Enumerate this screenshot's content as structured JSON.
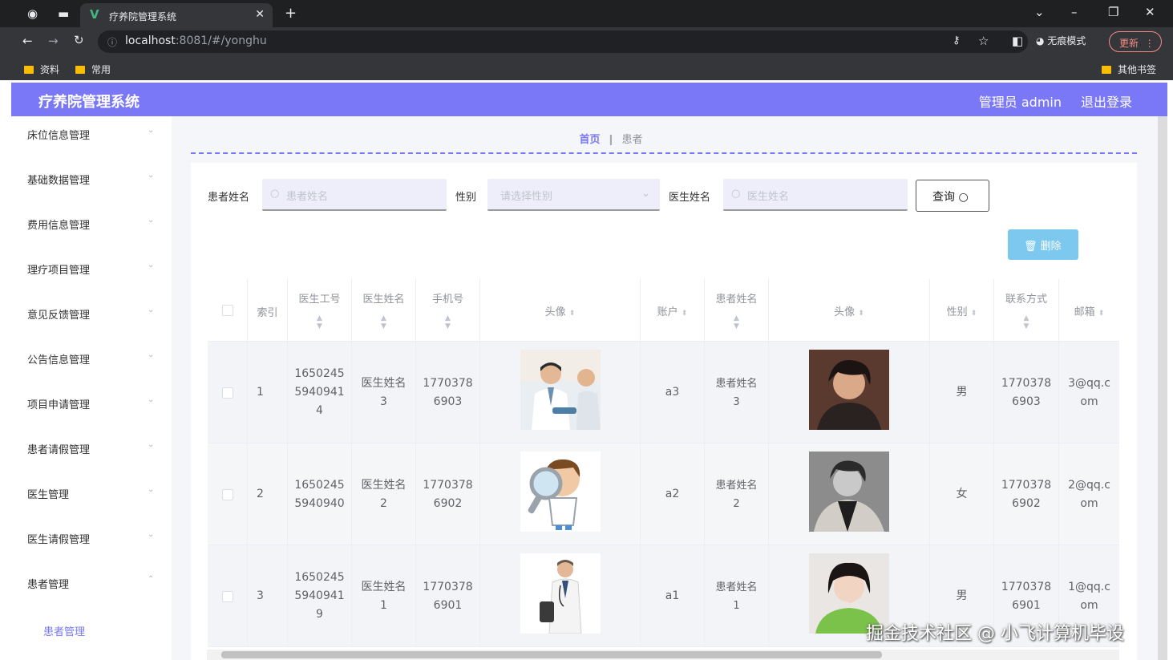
{
  "browser": {
    "tab_title": "疗养院管理系统",
    "url_host": "localhost",
    "url_rest": ":8081/#/yonghu",
    "incognito_label": "无痕模式",
    "update_label": "更新",
    "bookmarks": [
      "资料",
      "常用"
    ],
    "other_bookmarks": "其他书签"
  },
  "header": {
    "title": "疗养院管理系统",
    "admin": "管理员 admin",
    "logout": "退出登录"
  },
  "sidebar": {
    "items": [
      {
        "label": "床位信息管理"
      },
      {
        "label": "基础数据管理"
      },
      {
        "label": "费用信息管理"
      },
      {
        "label": "理疗项目管理"
      },
      {
        "label": "意见反馈管理"
      },
      {
        "label": "公告信息管理"
      },
      {
        "label": "项目申请管理"
      },
      {
        "label": "患者请假管理"
      },
      {
        "label": "医生管理"
      },
      {
        "label": "医生请假管理"
      },
      {
        "label": "患者管理"
      }
    ],
    "sub_item": "患者管理"
  },
  "breadcrumb": {
    "home": "首页",
    "current": "患者"
  },
  "filters": {
    "patient_name_label": "患者姓名",
    "patient_name_placeholder": "患者姓名",
    "gender_label": "性别",
    "gender_placeholder": "请选择性别",
    "doctor_name_label": "医生姓名",
    "doctor_name_placeholder": "医生姓名",
    "query_label": "查询",
    "delete_label": "删除"
  },
  "table": {
    "headers": [
      "索引",
      "医生工号",
      "医生姓名",
      "手机号",
      "头像",
      "账户",
      "患者姓名",
      "头像",
      "性别",
      "联系方式",
      "邮箱"
    ],
    "rows": [
      {
        "index": "1",
        "doc_id": [
          "1650245",
          "5940941",
          "4"
        ],
        "doc_name": [
          "医生姓名",
          "3"
        ],
        "phone": [
          "1770378",
          "6903"
        ],
        "account": "a3",
        "patient": [
          "患者姓名",
          "3"
        ],
        "gender": "男",
        "contact": [
          "1770378",
          "6903"
        ],
        "email": [
          "3@qq.c",
          "om"
        ]
      },
      {
        "index": "2",
        "doc_id": [
          "1650245",
          "5940940"
        ],
        "doc_name": [
          "医生姓名",
          "2"
        ],
        "phone": [
          "1770378",
          "6902"
        ],
        "account": "a2",
        "patient": [
          "患者姓名",
          "2"
        ],
        "gender": "女",
        "contact": [
          "1770378",
          "6902"
        ],
        "email": [
          "2@qq.c",
          "om"
        ]
      },
      {
        "index": "3",
        "doc_id": [
          "1650245",
          "5940941",
          "9"
        ],
        "doc_name": [
          "医生姓名",
          "1"
        ],
        "phone": [
          "1770378",
          "6901"
        ],
        "account": "a1",
        "patient": [
          "患者姓名",
          "1"
        ],
        "gender": "男",
        "contact": [
          "1770378",
          "6901"
        ],
        "email": [
          "1@qq.c",
          "om"
        ]
      }
    ]
  },
  "watermark": "掘金技术社区 @ 小飞计算机毕设",
  "colors": {
    "accent": "#7a78f7",
    "delete_btn": "#7cc8ef",
    "chrome_dark": "#202124"
  }
}
